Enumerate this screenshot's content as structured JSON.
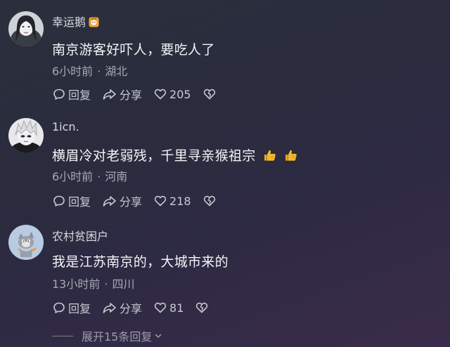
{
  "comments": [
    {
      "username": "幸运鹅",
      "badge": "lion-badge-icon",
      "text": "南京游客好吓人，要吃人了",
      "time": "6小时前",
      "location": "湖北",
      "reply_label": "回复",
      "share_label": "分享",
      "likes": "205"
    },
    {
      "username": "1icn.",
      "text": "横眉冷对老弱残，千里寻亲猴祖宗",
      "emojis": [
        "thumbs-up-icon",
        "thumbs-up-icon"
      ],
      "time": "6小时前",
      "location": "河南",
      "reply_label": "回复",
      "share_label": "分享",
      "likes": "218"
    },
    {
      "username": "农村贫困户",
      "text": "我是江苏南京的，大城市来的",
      "time": "13小时前",
      "location": "四川",
      "reply_label": "回复",
      "share_label": "分享",
      "likes": "81"
    }
  ],
  "expand_label": "展开15条回复",
  "meta_separator": "·",
  "colors": {
    "background": "#2b2d3d",
    "text_primary": "#f3f3f6",
    "text_secondary": "#a7a8b3",
    "thumb": "#f5b92e"
  }
}
